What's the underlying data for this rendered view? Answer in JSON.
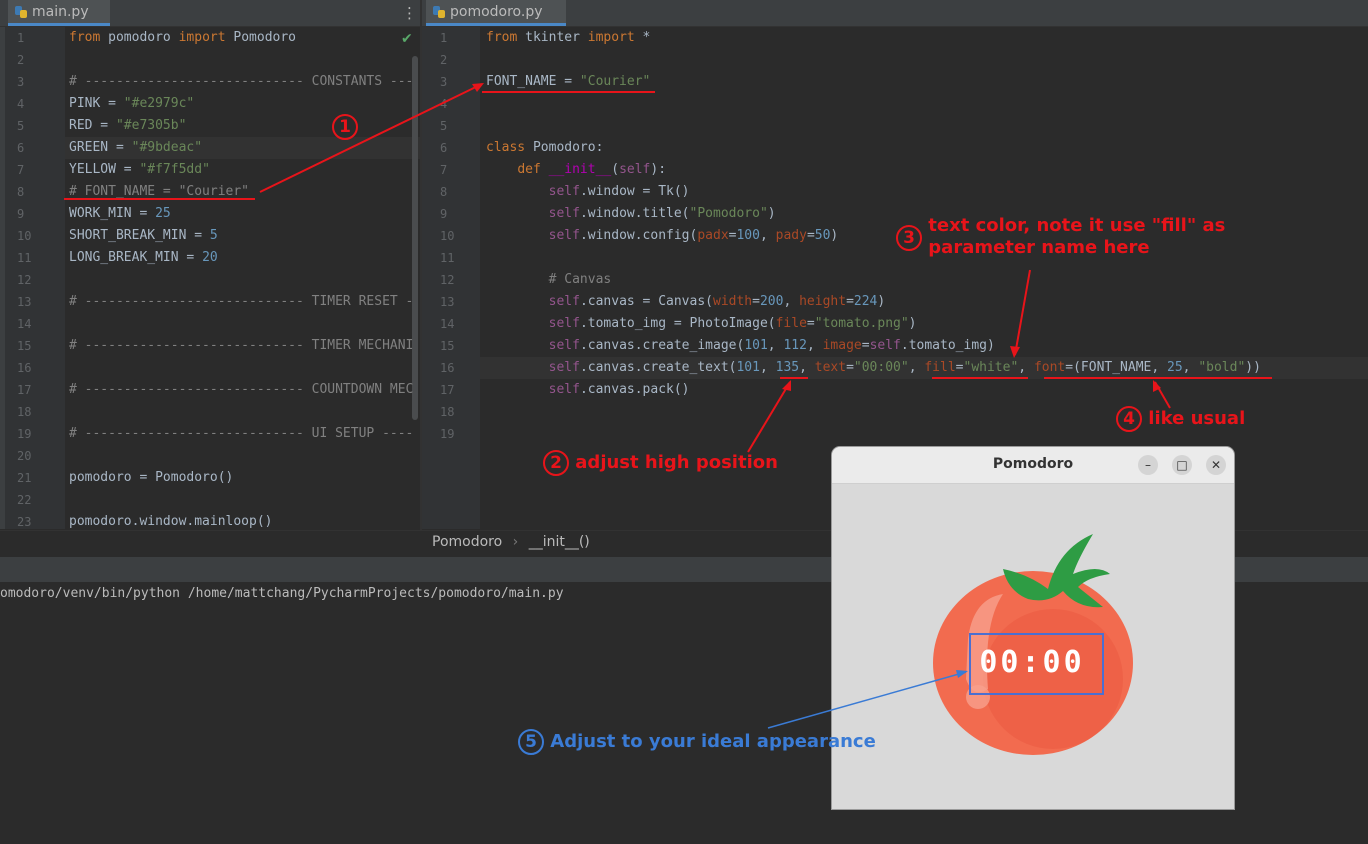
{
  "left_tab": {
    "label": "main.py"
  },
  "right_tab": {
    "label": "pomodoro.py"
  },
  "main_code": [
    {
      "n": "1",
      "html": "<span class='kw'>from</span> pomodoro <span class='kw'>import</span> Pomodoro"
    },
    {
      "n": "2",
      "html": ""
    },
    {
      "n": "3",
      "html": "<span class='cmt'># ---------------------------- CONSTANTS -----</span>"
    },
    {
      "n": "4",
      "html": "PINK = <span class='str'>\"#e2979c\"</span>"
    },
    {
      "n": "5",
      "html": "RED = <span class='str'>\"#e7305b\"</span>"
    },
    {
      "n": "6",
      "html": "GREEN = <span class='str'>\"#9bdeac\"</span>"
    },
    {
      "n": "7",
      "html": "YELLOW = <span class='str'>\"#f7f5dd\"</span>"
    },
    {
      "n": "8",
      "html": "<span class='cmt'># FONT_NAME = \"Courier\"</span>"
    },
    {
      "n": "9",
      "html": "WORK_MIN = <span class='num'>25</span>"
    },
    {
      "n": "10",
      "html": "SHORT_BREAK_MIN = <span class='num'>5</span>"
    },
    {
      "n": "11",
      "html": "LONG_BREAK_MIN = <span class='num'>20</span>"
    },
    {
      "n": "12",
      "html": ""
    },
    {
      "n": "13",
      "html": "<span class='cmt'># ---------------------------- TIMER RESET --</span>"
    },
    {
      "n": "14",
      "html": ""
    },
    {
      "n": "15",
      "html": "<span class='cmt'># ---------------------------- TIMER MECHANI</span>"
    },
    {
      "n": "16",
      "html": ""
    },
    {
      "n": "17",
      "html": "<span class='cmt'># ---------------------------- COUNTDOWN MEC</span>"
    },
    {
      "n": "18",
      "html": ""
    },
    {
      "n": "19",
      "html": "<span class='cmt'># ---------------------------- UI SETUP ----</span>"
    },
    {
      "n": "20",
      "html": ""
    },
    {
      "n": "21",
      "html": "pomodoro = Pomodoro()"
    },
    {
      "n": "22",
      "html": ""
    },
    {
      "n": "23",
      "html": "pomodoro.window.mainloop()"
    }
  ],
  "pomo_code": [
    {
      "n": "1",
      "html": "<span class='kw'>from</span> tkinter <span class='kw'>import</span> *"
    },
    {
      "n": "2",
      "html": ""
    },
    {
      "n": "3",
      "html": "FONT_NAME = <span class='str'>\"Courier\"</span>"
    },
    {
      "n": "4",
      "html": ""
    },
    {
      "n": "5",
      "html": ""
    },
    {
      "n": "6",
      "html": "<span class='kw'>class</span> Pomodoro:"
    },
    {
      "n": "7",
      "html": "    <span class='kw'>def</span> <span class='magic'>__init__</span>(<span class='self'>self</span>):"
    },
    {
      "n": "8",
      "html": "        <span class='self'>self</span>.window = Tk()"
    },
    {
      "n": "9",
      "html": "        <span class='self'>self</span>.window.title(<span class='str'>\"Pomodoro\"</span>)"
    },
    {
      "n": "10",
      "html": "        <span class='self'>self</span>.window.config(<span class='param'>padx</span>=<span class='num'>100</span>, <span class='param'>pady</span>=<span class='num'>50</span>)"
    },
    {
      "n": "11",
      "html": ""
    },
    {
      "n": "12",
      "html": "        <span class='cmt'># Canvas</span>"
    },
    {
      "n": "13",
      "html": "        <span class='self'>self</span>.canvas = Canvas(<span class='param'>width</span>=<span class='num'>200</span>, <span class='param'>height</span>=<span class='num'>224</span>)"
    },
    {
      "n": "14",
      "html": "        <span class='self'>self</span>.tomato_img = PhotoImage(<span class='param'>file</span>=<span class='str'>\"tomato.png\"</span>)"
    },
    {
      "n": "15",
      "html": "        <span class='self'>self</span>.canvas.create_image(<span class='num'>101</span>, <span class='num'>112</span>, <span class='param'>image</span>=<span class='self'>self</span>.tomato_img)"
    },
    {
      "n": "16",
      "html": "        <span class='self'>self</span>.canvas.create_text(<span class='num'>101</span>, <span class='num'>135</span>, <span class='param'>text</span>=<span class='str'>\"00:00\"</span>, <span class='param'>fill</span>=<span class='str'>\"white\"</span>, <span class='param'>font</span>=(FONT_NAME, <span class='num'>25</span>, <span class='str'>\"bold\"</span>))"
    },
    {
      "n": "17",
      "html": "        <span class='self'>self</span>.canvas.pack()"
    },
    {
      "n": "18",
      "html": ""
    },
    {
      "n": "19",
      "html": ""
    }
  ],
  "breadcrumb": {
    "class_name": "Pomodoro",
    "sep": "›",
    "method": "__init__()"
  },
  "terminal": {
    "line": "omodoro/venv/bin/python /home/mattchang/PycharmProjects/pomodoro/main.py"
  },
  "tk_window": {
    "title": "Pomodoro",
    "timer": "00:00",
    "min": "–",
    "max": "□",
    "close": "✕"
  },
  "annotations": {
    "a1": {
      "num": "1"
    },
    "a2": {
      "num": "2",
      "text": "adjust high position"
    },
    "a3": {
      "num": "3",
      "text1": "text color, note it use \"fill\" as",
      "text2": "parameter name here"
    },
    "a4": {
      "num": "4",
      "text": "like usual"
    },
    "a5": {
      "num": "5",
      "text": "Adjust to your ideal appearance"
    }
  },
  "colors": {
    "annotation_red": "#e8141a",
    "annotation_blue": "#3a7bd5",
    "tomato": "#f26b4f",
    "leaf": "#2e9c44"
  }
}
